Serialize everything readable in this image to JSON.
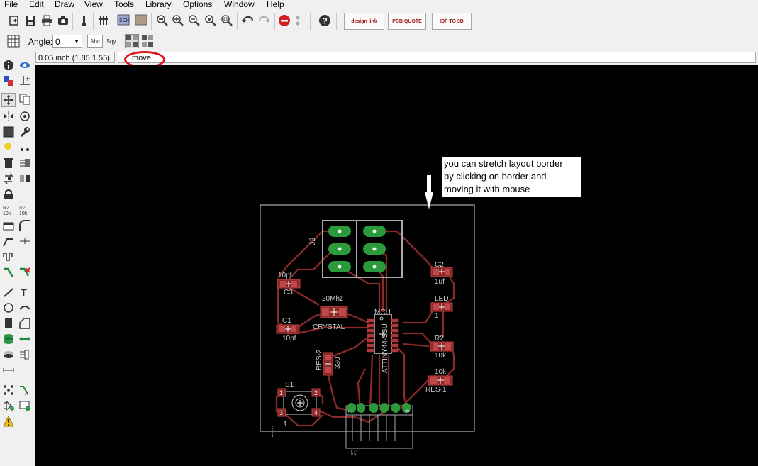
{
  "menu": [
    "File",
    "Edit",
    "Draw",
    "View",
    "Tools",
    "Library",
    "Options",
    "Window",
    "Help"
  ],
  "toolbar": {
    "design_link": "design link",
    "pcb_quote": "PCB QUOTE",
    "idf_3d": "IDF TO 3D"
  },
  "parambar": {
    "angle_label": "Angle:",
    "angle_value": "0",
    "abc_label": "Abc",
    "sqy_label": "5qy"
  },
  "cmdbar": {
    "coordinates": "0.05 inch (1.85 1.55)",
    "command": "move"
  },
  "annotation": {
    "line1": "you can stretch layout border",
    "line2": "by clicking on border and",
    "line3": "moving it with mouse"
  },
  "pcb": {
    "j2": "J2",
    "c3_value": "10pf",
    "c3_name": "C3",
    "crystal_value": "20Mhz",
    "crystal_name": "CRYSTAL",
    "c1_name": "C1",
    "c1_value": "10pf",
    "mcu_label": "MCU",
    "mcu_part": "ATTINY44-SSU",
    "c2_name": "C2",
    "c2_value": "1uf",
    "led_name": "LED",
    "led_value": "1",
    "r2_name": "R2",
    "r2_value": "10k",
    "res1_value": "10k",
    "res1_name": "RES-1",
    "res2_name": "RES-2",
    "res2_value": "330",
    "s1_name": "S1",
    "s1_pin1": "1",
    "s1_pin2": "2",
    "s1_pin3": "3",
    "s1_pin4": "4",
    "s1_t": "t",
    "j1_name": "J1",
    "j1_pin1": "1",
    "j1_pin6": "6"
  }
}
